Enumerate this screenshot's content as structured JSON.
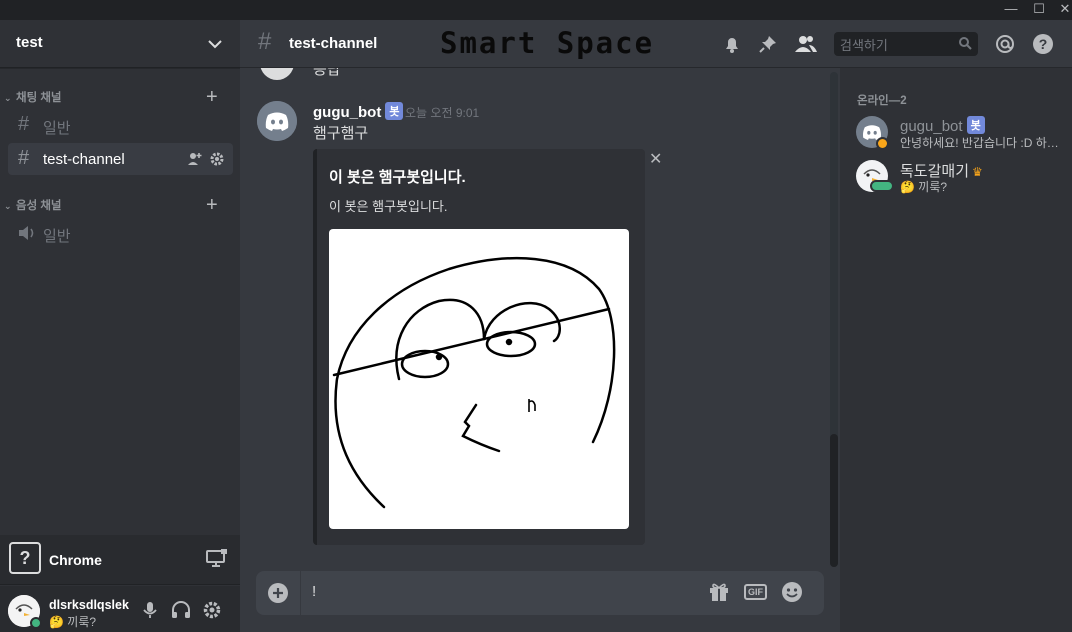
{
  "window": {
    "minimize": "—",
    "maximize": "☐",
    "close": "✕"
  },
  "guild": {
    "name": "test"
  },
  "sidebar": {
    "text_category": "채팅 채널",
    "voice_category": "음성 채널",
    "channels": [
      {
        "label": "일반",
        "type": "text"
      },
      {
        "label": "test-channel",
        "type": "text",
        "active": true
      },
      {
        "label": "일반",
        "type": "voice"
      }
    ]
  },
  "stream": {
    "icon": "?",
    "label": "Chrome"
  },
  "user": {
    "name": "dlsrksdlqslek",
    "status": "🤔 끼룩?"
  },
  "header": {
    "channel": "test-channel",
    "watermark": "Smart Space",
    "search_placeholder": "검색하기"
  },
  "messages": {
    "partial_text": "응답",
    "author": "gugu_bot",
    "bot_tag": "봇",
    "time": "오늘 오전 9:01",
    "text": "햄구햄구",
    "embed": {
      "title": "이 봇은 햄구봇입니다.",
      "description": "이 봇은 햄구봇입니다."
    }
  },
  "composer": {
    "value": "!"
  },
  "members": {
    "category": "온라인—2",
    "list": [
      {
        "name": "gugu_bot",
        "bot_tag": "봇",
        "sub": "안녕하세요! 반갑습니다 :D 하는 중"
      },
      {
        "name": "독도갈매기",
        "crown": "♛",
        "sub": "🤔 끼룩?"
      }
    ]
  },
  "colors": {
    "accent": "#7289da",
    "online": "#43b581",
    "background": "#36393f",
    "sidebar": "#2f3136"
  }
}
